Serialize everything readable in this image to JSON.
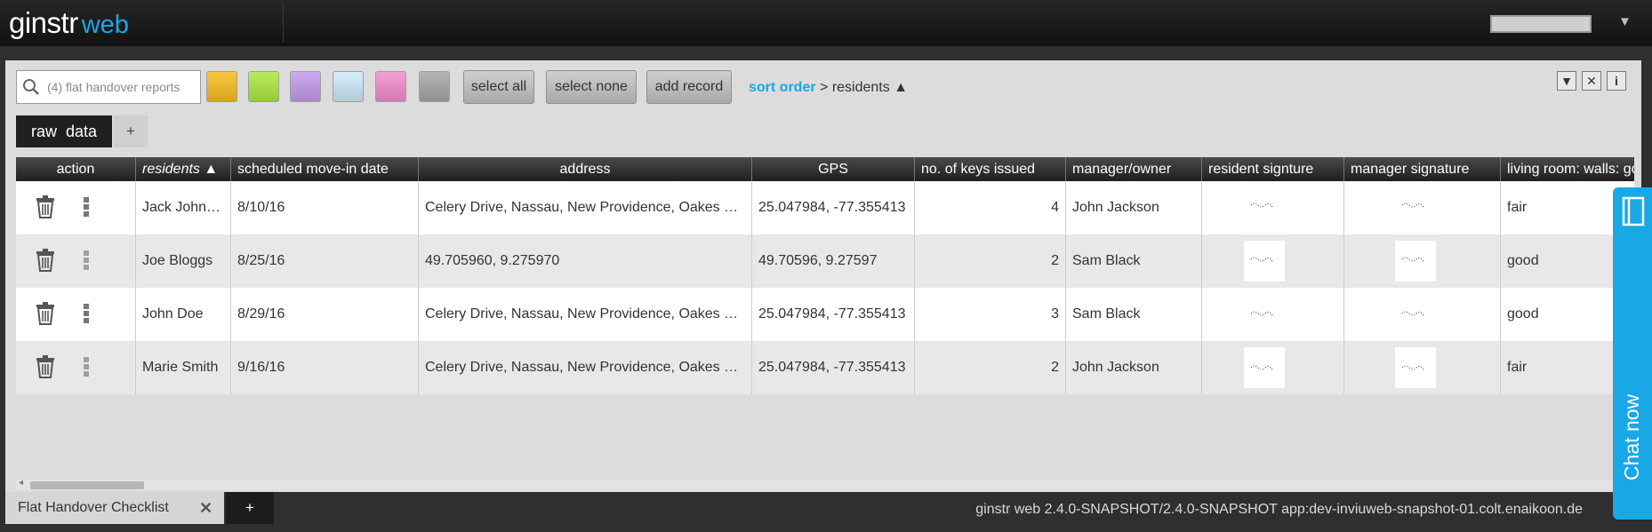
{
  "app": {
    "logo_main": "ginstr",
    "logo_sub": "web"
  },
  "toolbar": {
    "search_placeholder": "(4) flat handover reports",
    "swatches": [
      "#f9c83f",
      "#b9ec5a",
      "#cfa9f0",
      "#d6eefb",
      "#f59ed3",
      "#b4b4b4"
    ],
    "select_all": "select all",
    "select_none": "select none",
    "add_record": "add record",
    "sort_label": "sort order",
    "sort_sep": ">",
    "sort_field": "residents",
    "sort_dir": "▲",
    "filter_icon": "▼",
    "clear_icon": "✕",
    "info_icon": "i"
  },
  "views": {
    "active": "raw  data",
    "add": "+"
  },
  "table": {
    "columns": [
      "action",
      "residents ▲",
      "scheduled move-in date",
      "address",
      "GPS",
      "no. of keys issued",
      "manager/owner",
      "resident signture",
      "manager signature",
      "living room: walls: good"
    ],
    "rows": [
      {
        "resident": "Jack Johnson",
        "date": "8/10/16",
        "address": "Celery Drive, Nassau, New Providence, Oakes Field",
        "gps": "25.047984, -77.355413",
        "keys": "4",
        "manager": "John Jackson",
        "living": "fair"
      },
      {
        "resident": "Joe Bloggs",
        "date": "8/25/16",
        "address": "49.705960, 9.275970",
        "gps": "49.70596, 9.27597",
        "keys": "2",
        "manager": "Sam Black",
        "living": "good"
      },
      {
        "resident": "John Doe",
        "date": "8/29/16",
        "address": "Celery Drive, Nassau, New Providence, Oakes Field",
        "gps": "25.047984, -77.355413",
        "keys": "3",
        "manager": "Sam Black",
        "living": "good"
      },
      {
        "resident": "Marie Smith",
        "date": "9/16/16",
        "address": "Celery Drive, Nassau, New Providence, Oakes Field",
        "gps": "25.047984, -77.355413",
        "keys": "2",
        "manager": "John Jackson",
        "living": "fair"
      }
    ]
  },
  "footer": {
    "tab_label": "Flat Handover Checklist",
    "close": "✕",
    "add": "+",
    "version": "ginstr web 2.4.0-SNAPSHOT/2.4.0-SNAPSHOT app:dev-inviuweb-snapshot-01.colt.enaikoon.de"
  },
  "chat": {
    "label": "Chat now"
  },
  "icons": {
    "search": "search-icon",
    "trash": "trash-icon",
    "more": "more-vertical-icon",
    "chat": "chat-book-icon"
  }
}
